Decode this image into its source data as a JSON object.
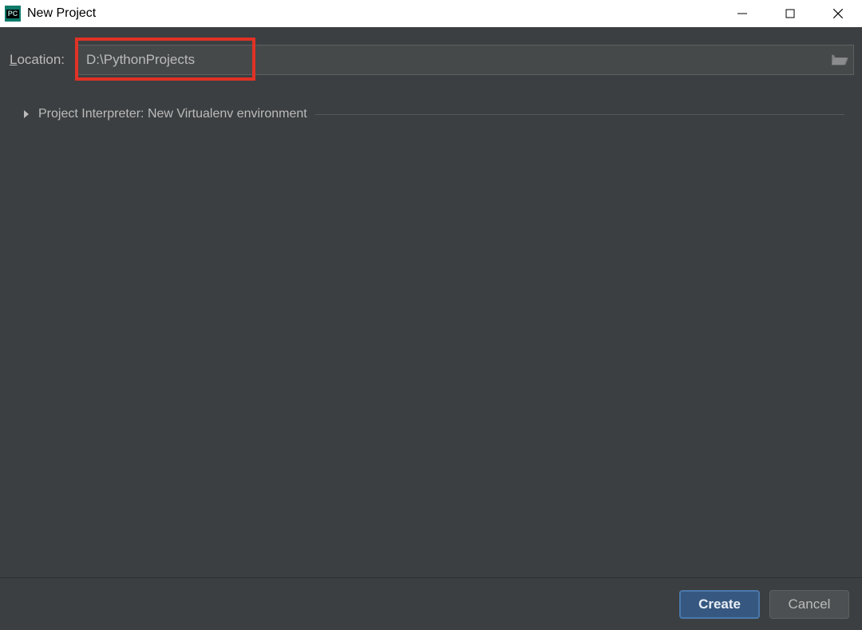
{
  "window": {
    "title": "New Project",
    "app_icon_text": "PC"
  },
  "form": {
    "location_label_prefix": "L",
    "location_label_rest": "ocation:",
    "location_value": "D:\\PythonProjects",
    "interpreter_section_label": "Project Interpreter: New Virtualenv environment"
  },
  "footer": {
    "create_label": "Create",
    "cancel_label": "Cancel"
  }
}
